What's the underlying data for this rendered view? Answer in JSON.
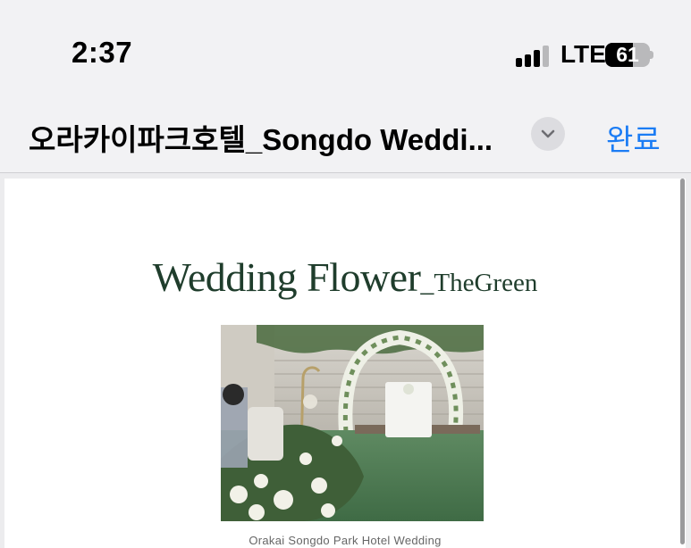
{
  "status_bar": {
    "time": "2:37",
    "network": "LTE",
    "battery_level": "61",
    "signal_bars_active": 3,
    "signal_bars_total": 4
  },
  "nav": {
    "title": "오라카이파크호텔_Songdo Weddi...",
    "done_label": "완료",
    "accent_color": "#1b7cf4"
  },
  "document": {
    "title_main": "Wedding Flower",
    "title_separator": "_",
    "title_sub": "TheGreen",
    "title_color": "#1f3d2c",
    "photo_caption": "Orakai Songdo Park Hotel Wedding"
  },
  "icons": {
    "dropdown": "chevron-down-icon",
    "signal": "cellular-signal-icon",
    "battery": "battery-icon"
  }
}
